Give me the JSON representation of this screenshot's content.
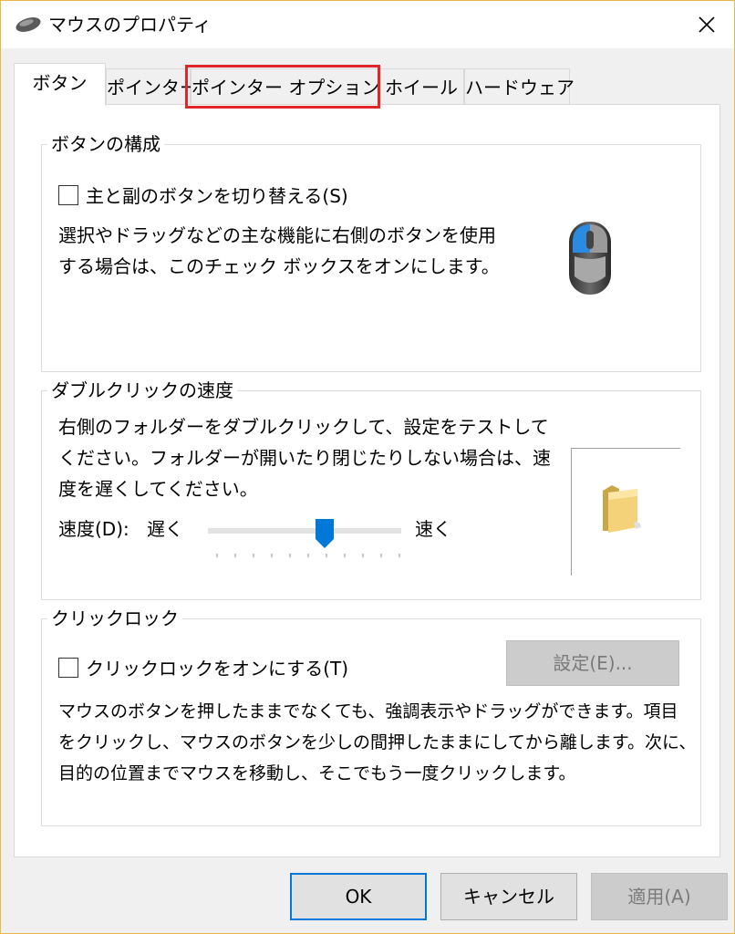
{
  "window": {
    "title": "マウスのプロパティ"
  },
  "tabs": [
    {
      "label": "ボタン",
      "active": true
    },
    {
      "label": "ポインター",
      "active": false
    },
    {
      "label": "ポインター オプション",
      "active": false,
      "highlighted": true
    },
    {
      "label": "ホイール",
      "active": false
    },
    {
      "label": "ハードウェア",
      "active": false
    }
  ],
  "button_config": {
    "group_label": "ボタンの構成",
    "swap_checkbox_label": "主と副のボタンを切り替える(S)",
    "swap_checked": false,
    "description_line1": "選択やドラッグなどの主な機能に右側のボタンを使用",
    "description_line2": "する場合は、このチェック ボックスをオンにします。"
  },
  "double_click": {
    "group_label": "ダブルクリックの速度",
    "description_line1": "右側のフォルダーをダブルクリックして、設定をテストして",
    "description_line2": "ください。フォルダーが開いたり閉じたりしない場合は、速",
    "description_line3": "度を遅くしてください。",
    "speed_label": "速度(D):",
    "slow_label": "遅く",
    "fast_label": "速く",
    "slider_value_fraction": 0.59
  },
  "click_lock": {
    "group_label": "クリックロック",
    "checkbox_label": "クリックロックをオンにする(T)",
    "checked": false,
    "settings_button": "設定(E)...",
    "description_line1": "マウスのボタンを押したままでなくても、強調表示やドラッグができます。項目",
    "description_line2": "をクリックし、マウスのボタンを少しの間押したままにしてから離します。次に、",
    "description_line3": "目的の位置までマウスを移動し、そこでもう一度クリックします。"
  },
  "footer": {
    "ok": "OK",
    "cancel": "キャンセル",
    "apply": "適用(A)"
  },
  "colors": {
    "highlight": "#e0262b",
    "accent": "#0078d7"
  }
}
